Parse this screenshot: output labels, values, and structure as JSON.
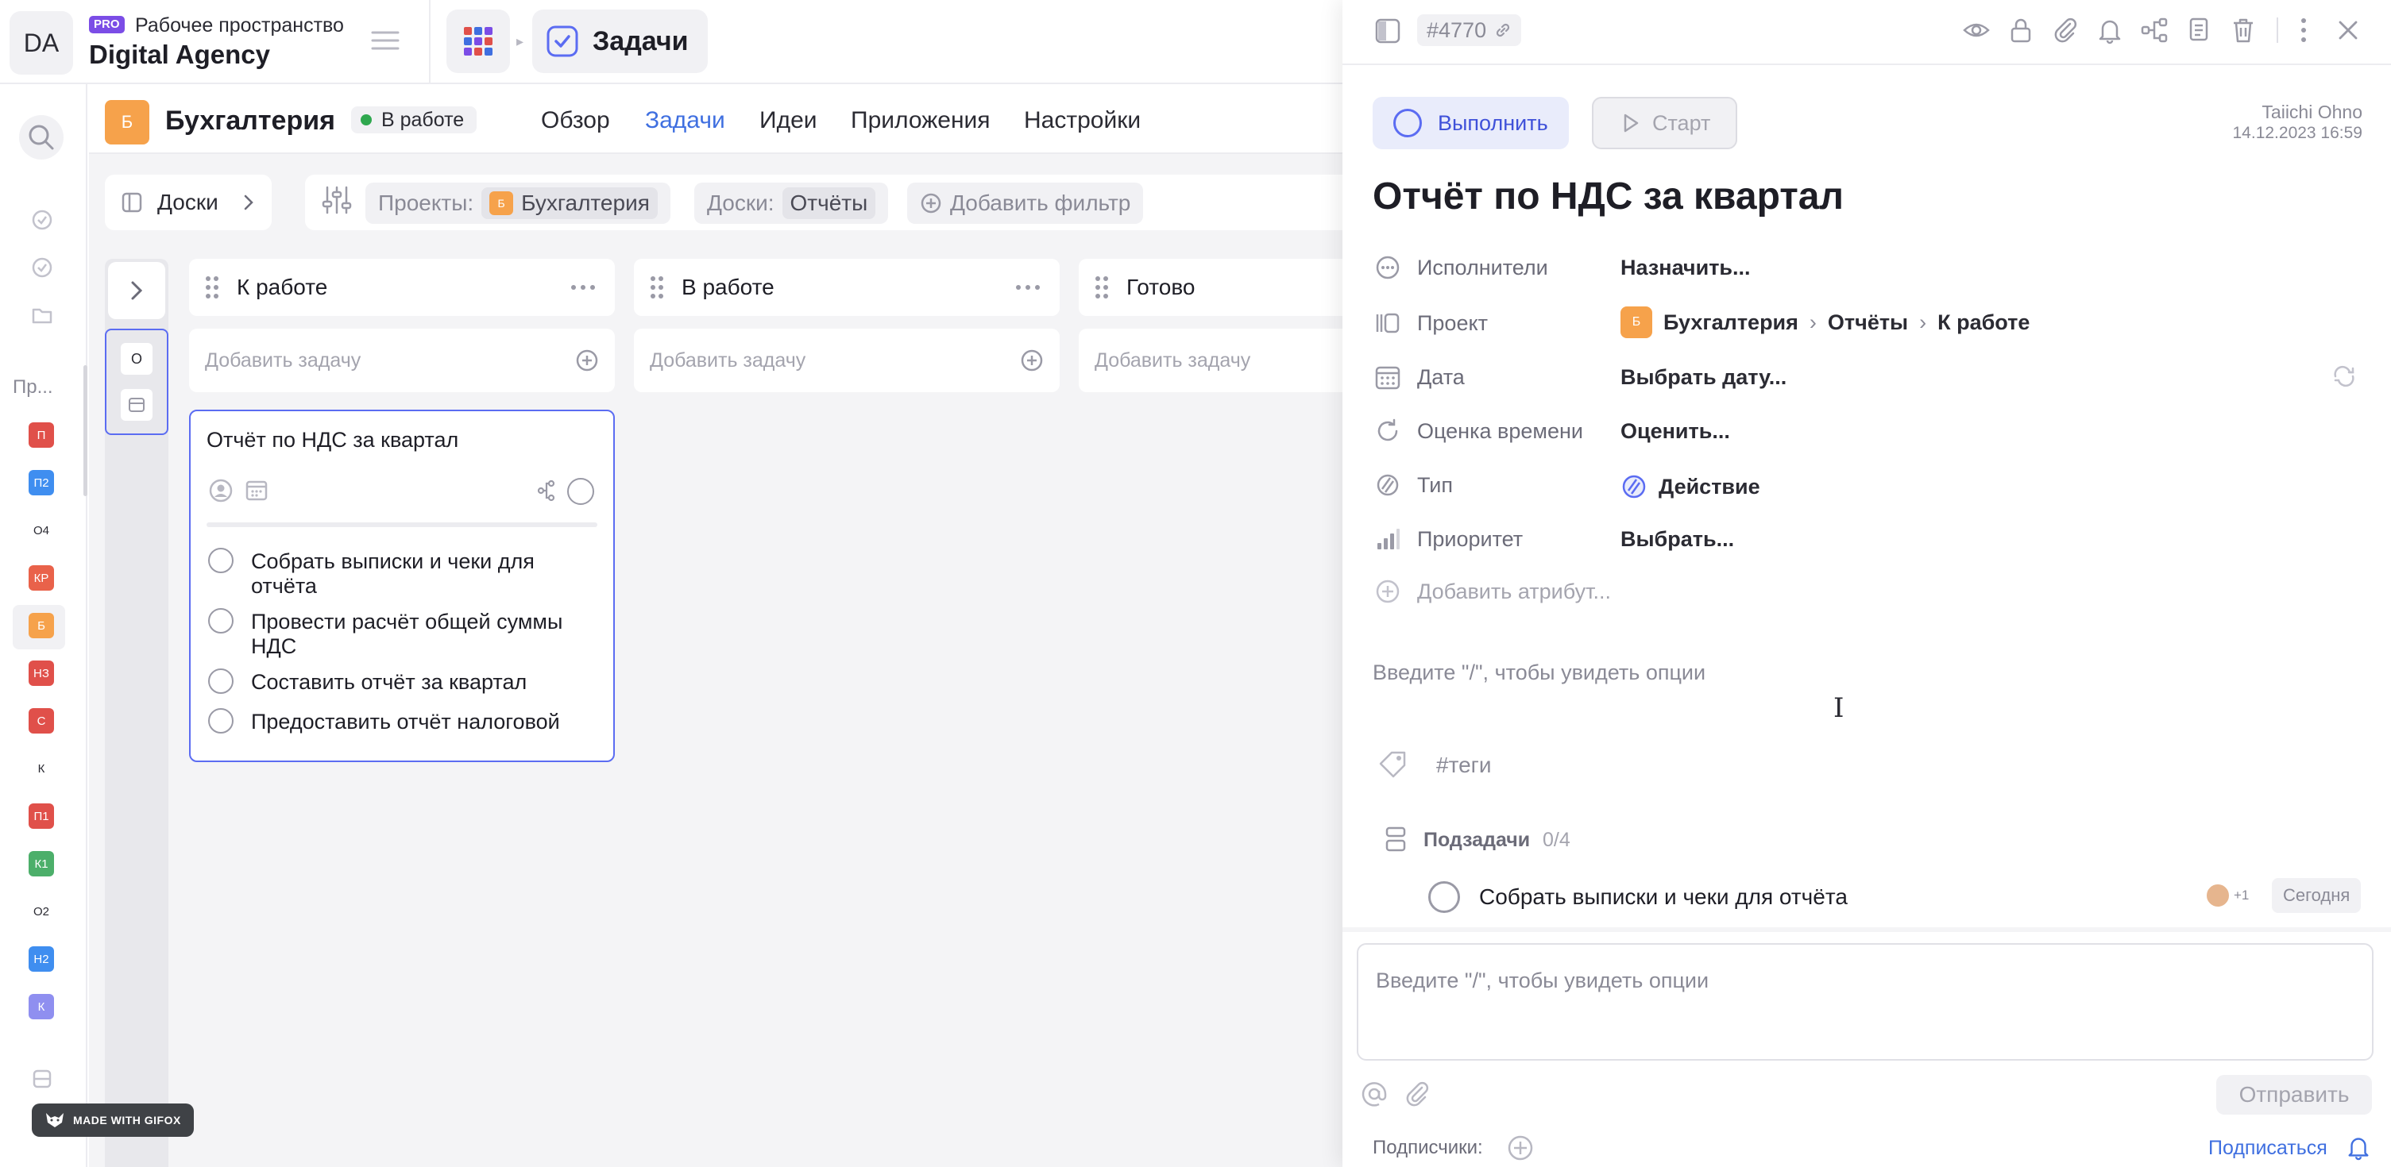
{
  "workspace": {
    "avatar": "DA",
    "pro_badge": "PRO",
    "label": "Рабочее пространство",
    "name": "Digital Agency"
  },
  "breadcrumb": {
    "section": "Задачи"
  },
  "rail": {
    "projects_label": "Пр...",
    "projects": [
      {
        "label": "П",
        "color": "#e0504a"
      },
      {
        "label": "П2",
        "color": "#3f8ef0"
      },
      {
        "label": "О4",
        "color": ""
      },
      {
        "label": "КР",
        "color": "#e9624a"
      },
      {
        "label": "Б",
        "color": "#f6a24b"
      },
      {
        "label": "НЗ",
        "color": "#e0504a"
      },
      {
        "label": "С",
        "color": "#e0504a"
      },
      {
        "label": "К",
        "color": ""
      },
      {
        "label": "П1",
        "color": "#e0504a"
      },
      {
        "label": "К1",
        "color": "#4caf6a"
      },
      {
        "label": "О2",
        "color": ""
      },
      {
        "label": "Н2",
        "color": "#3f8ef0"
      },
      {
        "label": "К",
        "color": "#8f8ff0"
      }
    ]
  },
  "project": {
    "avatar": "Б",
    "name": "Бухгалтерия",
    "status": "В работе",
    "status_color": "#2fa84f",
    "tabs": [
      "Обзор",
      "Задачи",
      "Идеи",
      "Приложения",
      "Настройки"
    ],
    "active_tab": "Задачи"
  },
  "toolbar": {
    "boards_label": "Доски",
    "filters": [
      {
        "label": "Проекты:",
        "value": "Бухгалтерия",
        "badge": "Б"
      },
      {
        "label": "Доски:",
        "value": "Отчёты"
      }
    ],
    "add_filter": "Добавить фильтр"
  },
  "collapsed_column": {
    "items": [
      "О",
      ""
    ]
  },
  "columns": [
    {
      "title": "К работе",
      "add_placeholder": "Добавить задачу"
    },
    {
      "title": "В работе",
      "add_placeholder": "Добавить задачу"
    },
    {
      "title": "Готово",
      "add_placeholder": "Добавить задачу"
    }
  ],
  "card": {
    "title": "Отчёт по НДС за квартал",
    "checklist": [
      "Собрать выписки и чеки для отчёта",
      "Провести расчёт общей суммы НДС",
      "Составить отчёт за квартал",
      "Предоставить отчёт налоговой"
    ]
  },
  "panel": {
    "task_id": "#4770",
    "complete_label": "Выполнить",
    "start_label": "Старт",
    "author": "Taiichi Ohno",
    "created": "14.12.2023 16:59",
    "title": "Отчёт по НДС за квартал",
    "attributes": {
      "assignees": {
        "label": "Исполнители",
        "value": "Назначить..."
      },
      "project": {
        "label": "Проект",
        "badge": "Б",
        "path": [
          "Бухгалтерия",
          "Отчёты",
          "К работе"
        ]
      },
      "date": {
        "label": "Дата",
        "value": "Выбрать дату..."
      },
      "estimate": {
        "label": "Оценка времени",
        "value": "Оценить..."
      },
      "type": {
        "label": "Тип",
        "value": "Действие"
      },
      "priority": {
        "label": "Приоритет",
        "value": "Выбрать..."
      }
    },
    "add_attribute": "Добавить атрибут...",
    "description_placeholder": "Введите \"/\", чтобы увидеть опции",
    "tags_placeholder": "#теги",
    "subtasks": {
      "label": "Подзадачи",
      "count": "0/4",
      "items": [
        {
          "title": "Собрать выписки и чеки для отчёта",
          "extra_assignees": "+1",
          "due": "Сегодня"
        }
      ]
    },
    "comment_placeholder": "Введите \"/\", чтобы увидеть опции",
    "send_label": "Отправить",
    "subscribers_label": "Подписчики:",
    "subscribe_label": "Подписаться"
  },
  "watermark": "MADE WITH GIFOX",
  "colors": {
    "accent": "#3f6fe0",
    "selection_border": "#5b6cf2",
    "project_orange": "#f6a24b"
  }
}
